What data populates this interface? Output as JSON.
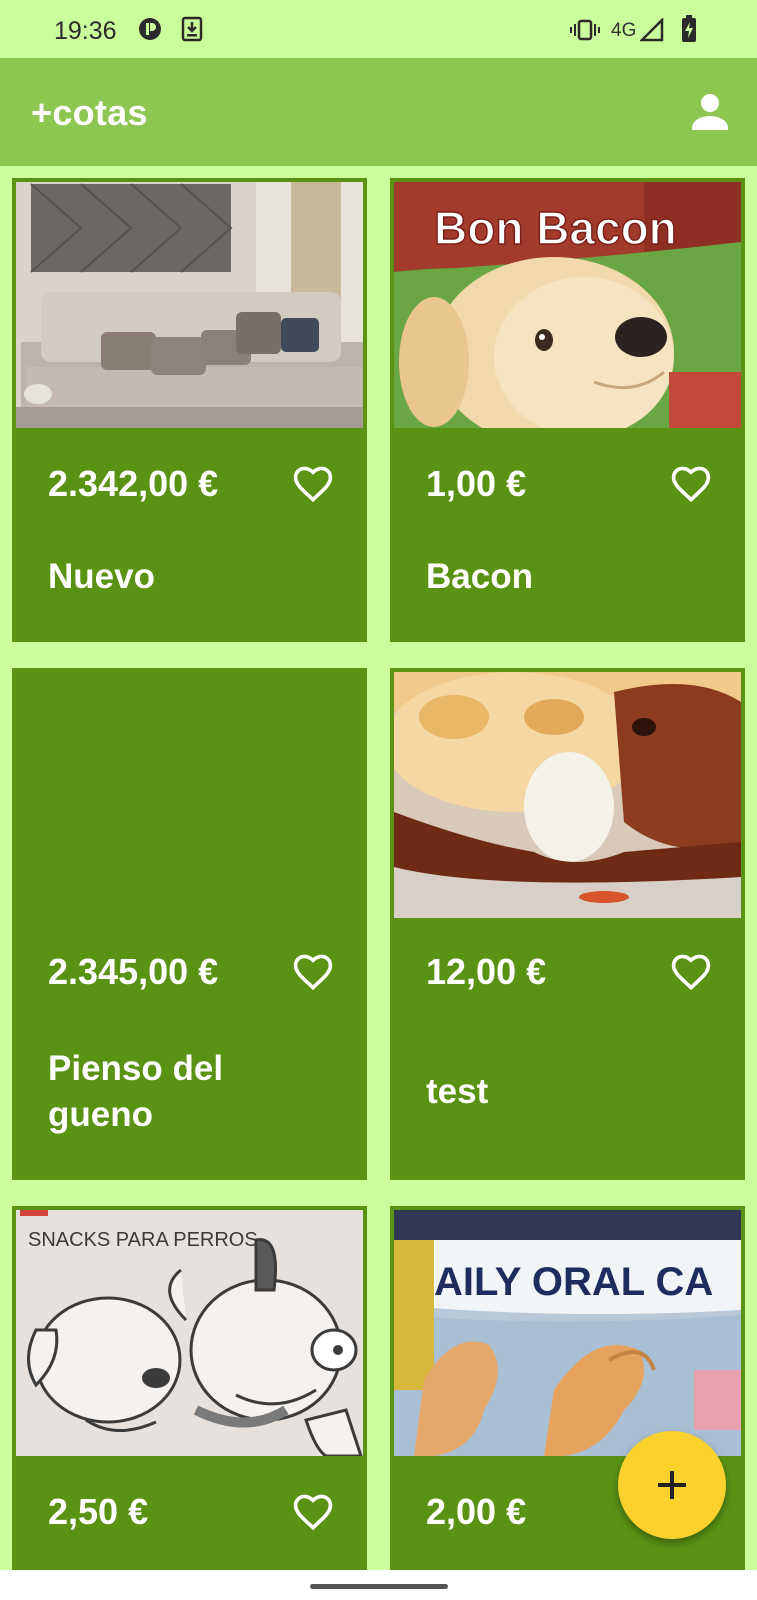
{
  "status_bar": {
    "time": "19:36",
    "network": "4G",
    "icons": [
      "app-notification-icon",
      "download-icon",
      "vibrate-icon",
      "signal-icon",
      "battery-charging-icon"
    ]
  },
  "app_bar": {
    "title": "+cotas",
    "profile_icon": "person-icon"
  },
  "colors": {
    "background": "#ccfd9c",
    "app_bar": "#8ec652",
    "card": "#5a9314",
    "fab": "#fdd12d"
  },
  "products": [
    {
      "price": "2.342,00 €",
      "name": "Nuevo",
      "image": "sofa-living-room"
    },
    {
      "price": "1,00 €",
      "name": "Bacon",
      "image": "dog-bacon-treats-package"
    },
    {
      "price": "2.345,00 €",
      "name": "Pienso del gueno",
      "image": ""
    },
    {
      "price": "12,00 €",
      "name": "test",
      "image": "grilled-food-closeup"
    },
    {
      "price": "2,50 €",
      "name": "",
      "image": "snacks-para-perros-drawing"
    },
    {
      "price": "2,00 €",
      "name": "",
      "image": "daily-oral-care-dog-chews"
    }
  ],
  "image_text": {
    "bacon_brand": "Bon Bacon",
    "snacks_caption": "SNACKS PARA PERROS",
    "oral_care_label": "AILY ORAL CA"
  },
  "fab": {
    "icon": "plus-icon"
  }
}
